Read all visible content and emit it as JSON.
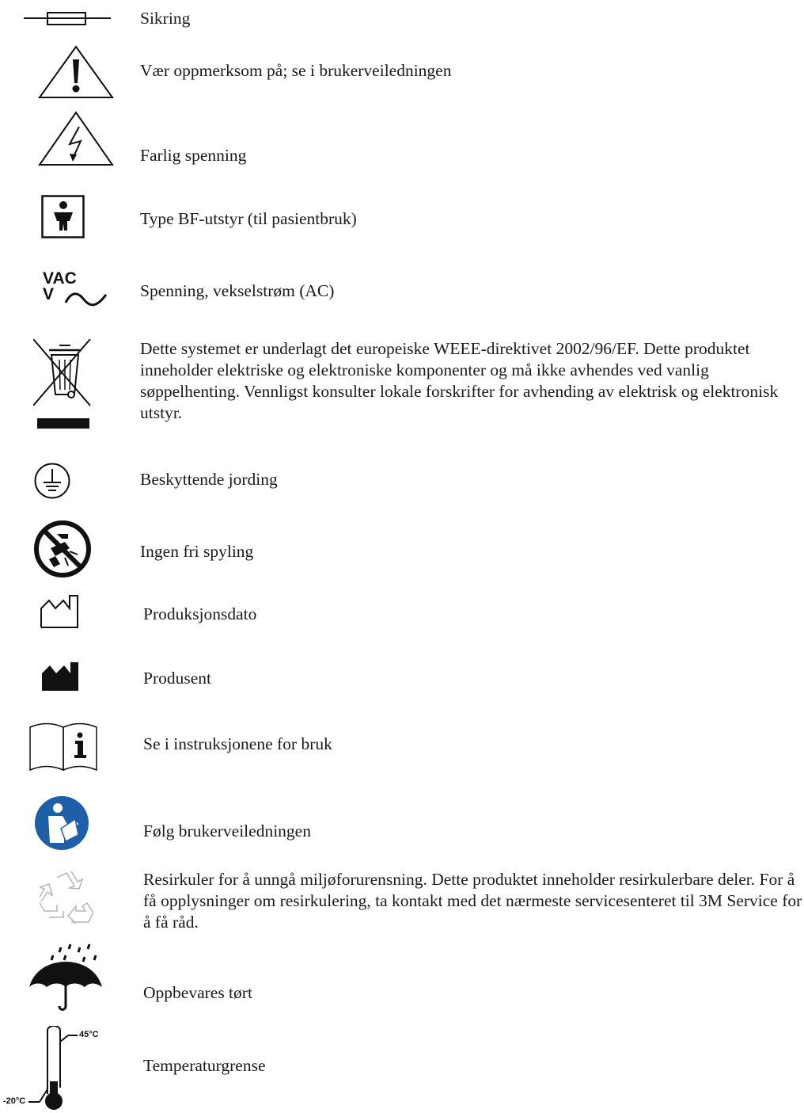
{
  "symbols": [
    {
      "icon": "fuse-icon",
      "label": "Sikring"
    },
    {
      "icon": "caution-icon",
      "label": "Vær oppmerksom på; se i brukerveiledningen"
    },
    {
      "icon": "dangerous-voltage-icon",
      "label": "Farlig spenning"
    },
    {
      "icon": "type-bf-icon",
      "label": "Type BF-utstyr (til pasientbruk)"
    },
    {
      "icon": "ac-voltage-icon",
      "label": "Spenning, vekselstrøm (AC)"
    },
    {
      "icon": "weee-icon",
      "label": "Dette systemet er underlagt det europeiske WEEE-direktivet 2002/96/EF. Dette produktet inneholder elektriske og elektroniske komponenter og må ikke avhendes ved vanlig søppelhenting. Vennligst konsulter lokale forskrifter for avhending av elektrisk og elektronisk utstyr."
    },
    {
      "icon": "protective-earth-icon",
      "label": "Beskyttende jording"
    },
    {
      "icon": "no-free-rinsing-icon",
      "label": "Ingen fri spyling"
    },
    {
      "icon": "manufacture-date-icon",
      "label": "Produksjonsdato"
    },
    {
      "icon": "manufacturer-icon",
      "label": "Produsent"
    },
    {
      "icon": "instructions-icon",
      "label": "Se i instruksjonene for bruk"
    },
    {
      "icon": "follow-manual-icon",
      "label": "Følg brukerveiledningen"
    },
    {
      "icon": "recycle-icon",
      "label": "Resirkuler for å unngå miljøforurensning. Dette produktet inneholder resirkulerbare deler. For å få opplysninger om resirkulering, ta kontakt med det nærmeste servicesenteret til 3M Service for å få råd."
    },
    {
      "icon": "keep-dry-icon",
      "label": "Oppbevares tørt"
    },
    {
      "icon": "temperature-limit-icon",
      "label": "Temperaturgrense"
    }
  ],
  "icon_text": {
    "vac": "VAC",
    "v": "V",
    "temp_high": "45°C",
    "temp_low": "-20°C"
  },
  "colors": {
    "ink": "#1a1a1a",
    "follow_manual_blue": "#1f5fa8",
    "recycle_grey": "#b5b5b5"
  }
}
